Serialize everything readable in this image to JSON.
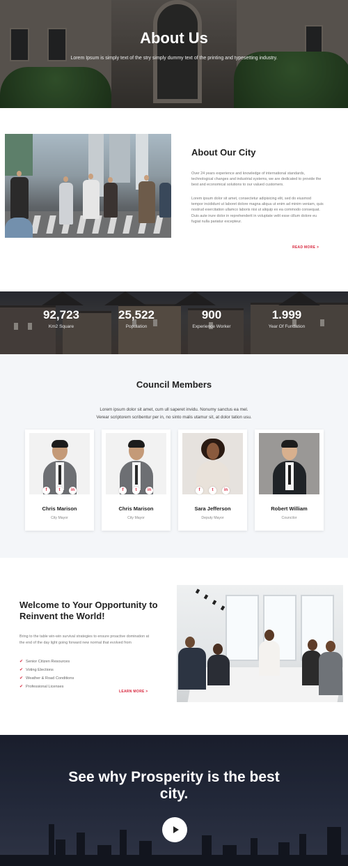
{
  "hero": {
    "title": "About Us",
    "subtitle": "Lorem Ipsum is simply text of the stry simply dummy text of the printing and typesetting industry."
  },
  "about": {
    "title": "About Our City",
    "paragraph1": "Over 24 years experience and knowledge of international standards, technological changes and industrial systems, we are dedicated to provide the best and economical solutions to our valued customers.",
    "paragraph2": "Lorem ipsum dolor sit amet, consectetur adipisicing elit, sed do eiusmod tempor incididunt ut laboret dolore magna aliqua ut enim ad minim veniam, quis nostrud exercitation ullamco laboris nisi ut aliquip ex ea commodo consequat. Duis aute irure dolor in reprehenderit in voluptate velit esse cillum dolore eu fugiat nulla pariatur excepteur.",
    "read_more": "READ MORE >"
  },
  "stats": [
    {
      "value": "92,723",
      "label": "Km2 Square"
    },
    {
      "value": "25,522",
      "label": "Population"
    },
    {
      "value": "900",
      "label": "Experience Worker"
    },
    {
      "value": "1.999",
      "label": "Year Of Fundation"
    }
  ],
  "council": {
    "title": "Council Members",
    "line1": "Lorem ipsum dolor sit amet, cum ull saperet invidu. Nonumy sanctus ea mel.",
    "line2": "Verear scriptorem scribentur per in, no sinto malis utamur sit, at dolor tation usu.",
    "social_icons": [
      "facebook-icon",
      "twitter-icon",
      "linkedin-icon"
    ],
    "social_glyphs": {
      "facebook": "f",
      "twitter": "t",
      "linkedin": "in"
    },
    "members": [
      {
        "name": "Chris Marison",
        "role": "City Mayor"
      },
      {
        "name": "Chris Marison",
        "role": "City Mayor"
      },
      {
        "name": "Sara Jefferson",
        "role": "Deputy Mayor"
      },
      {
        "name": "Robert William",
        "role": "Councilor"
      }
    ]
  },
  "opportunity": {
    "title": "Welcome to Your Opportunity to Reinvent the World!",
    "paragraph": "Bring to the table win-win survival strategies to ensure proactive domination at the end of the day light going forward new normal that evolved from",
    "items": [
      "Senior Citizen Resources",
      "Voting Elections",
      "Weather & Road Conditions",
      "Professional Licenses"
    ],
    "learn_more": "LEARN MORE >"
  },
  "prosperity": {
    "title": "See why Prosperity is the best city.",
    "play_icon": "play-icon"
  },
  "colors": {
    "accent": "#d7263d",
    "heading": "#222222",
    "body_text": "#777777",
    "section_bg": "#f4f6f9"
  }
}
